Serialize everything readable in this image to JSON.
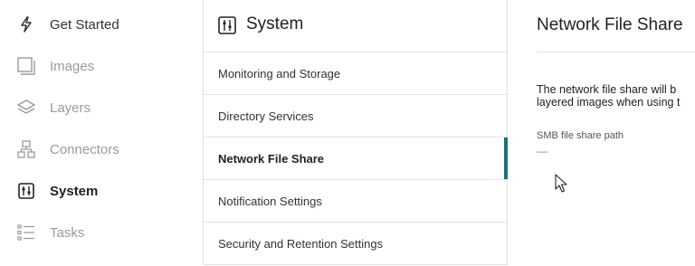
{
  "nav": {
    "items": [
      {
        "label": "Get Started",
        "icon": "lightning-icon",
        "state": "enabled"
      },
      {
        "label": "Images",
        "icon": "images-icon",
        "state": "disabled"
      },
      {
        "label": "Layers",
        "icon": "layers-icon",
        "state": "disabled"
      },
      {
        "label": "Connectors",
        "icon": "connectors-icon",
        "state": "disabled"
      },
      {
        "label": "System",
        "icon": "system-sliders-icon",
        "state": "active"
      },
      {
        "label": "Tasks",
        "icon": "tasks-list-icon",
        "state": "disabled"
      }
    ]
  },
  "panel": {
    "title": "System",
    "icon": "system-sliders-icon",
    "items": [
      {
        "label": "Monitoring and Storage"
      },
      {
        "label": "Directory Services"
      },
      {
        "label": "Network File Share",
        "selected": true
      },
      {
        "label": "Notification Settings"
      },
      {
        "label": "Security and Retention Settings"
      }
    ]
  },
  "detail": {
    "title": "Network File Share",
    "description_line1": "The network file share will b",
    "description_line2": "layered images when using t",
    "field_label": "SMB file share path",
    "field_value": "—"
  },
  "colors": {
    "accent": "#1f6f77",
    "disabled_text": "#9a9a9a",
    "divider": "#e3e3e3"
  }
}
